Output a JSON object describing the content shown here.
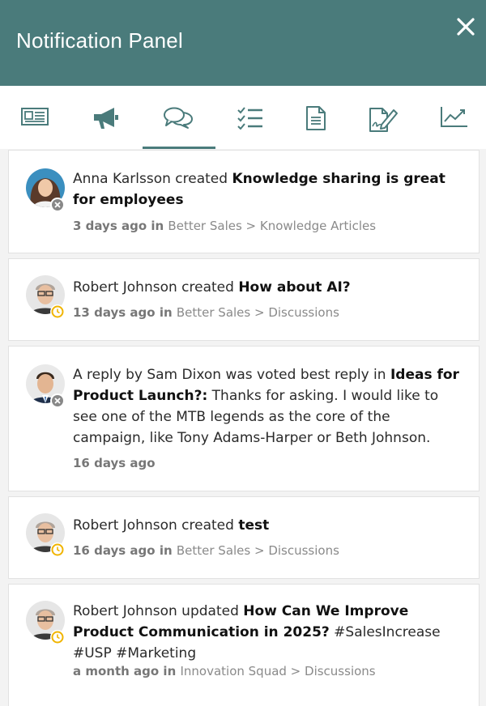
{
  "header": {
    "title": "Notification Panel",
    "close_icon": "close-icon"
  },
  "theme": {
    "accent": "#4a7b7b",
    "pending_badge": "#f0b400",
    "blocked_badge": "#888888"
  },
  "tabs": [
    {
      "name": "news",
      "icon": "newspaper-icon"
    },
    {
      "name": "announcements",
      "icon": "megaphone-icon"
    },
    {
      "name": "discussions",
      "icon": "chat-bubbles-icon",
      "active": true
    },
    {
      "name": "tasks",
      "icon": "checklist-icon"
    },
    {
      "name": "documents",
      "icon": "document-icon"
    },
    {
      "name": "edits",
      "icon": "signature-icon"
    },
    {
      "name": "analytics",
      "icon": "trend-chart-icon"
    }
  ],
  "notifications": [
    {
      "actor": "Anna Karlsson",
      "action": " created ",
      "subject": "Knowledge sharing is great for employees",
      "time": "3 days ago",
      "in": " in ",
      "path": "Better Sales > Knowledge Articles",
      "badge": "blocked"
    },
    {
      "actor": "Robert Johnson",
      "action": " created ",
      "subject": "How about AI?",
      "time": "13 days ago",
      "in": " in ",
      "path": "Better Sales > Discussions",
      "badge": "pending"
    },
    {
      "prefix": "A reply by ",
      "actor": "Sam Dixon",
      "action": " was voted best reply in ",
      "subject": "Ideas for Product Launch?:",
      "body": " Thanks for asking. I would like to see one of the MTB legends as the core of the campaign, like Tony Adams-Harper or Beth Johnson.",
      "time": "16 days ago",
      "badge": "blocked"
    },
    {
      "actor": "Robert Johnson",
      "action": " created ",
      "subject": "test",
      "time": "16 days ago",
      "in": " in ",
      "path": "Better Sales > Discussions",
      "badge": "pending"
    },
    {
      "actor": "Robert Johnson",
      "action": " updated ",
      "subject": "How Can We Improve Product Communication in 2025?",
      "body": " #SalesIncrease #USP #Marketing",
      "time": "a month ago",
      "in": " in ",
      "path": "Innovation Squad > Discussions",
      "badge": "pending"
    }
  ]
}
